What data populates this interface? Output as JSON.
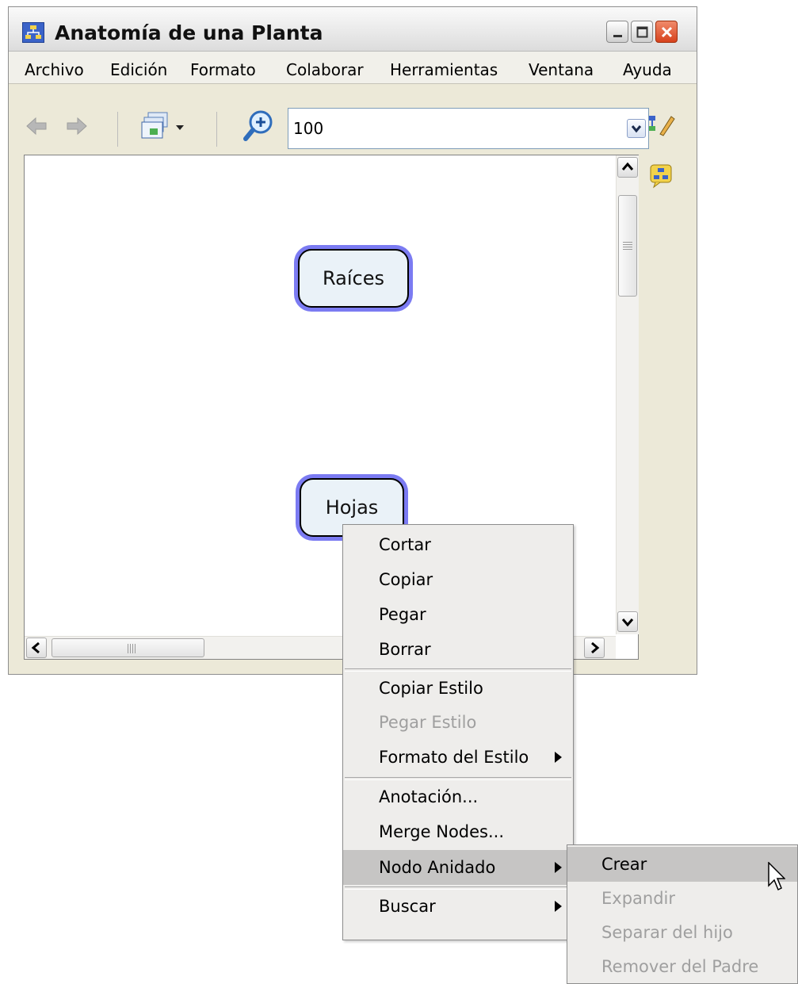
{
  "window": {
    "title": "Anatomía de una Planta",
    "controls": [
      "minimize",
      "maximize",
      "close"
    ]
  },
  "menubar": {
    "items": [
      "Archivo",
      "Edición",
      "Formato",
      "Colaborar",
      "Herramientas",
      "Ventana",
      "Ayuda"
    ]
  },
  "toolbar": {
    "icons": [
      "back-arrow-icon",
      "forward-arrow-icon",
      "view-selector-icon",
      "zoom-in-icon",
      "edit-style-icon"
    ],
    "zoom_value": "100"
  },
  "canvas": {
    "concepts": [
      "Raíces",
      "Hojas"
    ],
    "concept_fill": "#eaf2f8",
    "concept_halo": "#7b7bf2"
  },
  "context_menu": {
    "items": [
      {
        "label": "Cortar",
        "enabled": true
      },
      {
        "label": "Copiar",
        "enabled": true
      },
      {
        "label": "Pegar",
        "enabled": true
      },
      {
        "label": "Borrar",
        "enabled": true
      },
      {
        "label": "Copiar Estilo",
        "enabled": true
      },
      {
        "label": "Pegar Estilo",
        "enabled": false
      },
      {
        "label": "Formato del Estilo",
        "enabled": true,
        "submenu": true
      },
      {
        "label": "Anotación...",
        "enabled": true
      },
      {
        "label": "Merge Nodes...",
        "enabled": true
      },
      {
        "label": "Nodo Anidado",
        "enabled": true,
        "submenu": true,
        "highlighted": true
      },
      {
        "label": "Buscar",
        "enabled": true,
        "submenu": true
      }
    ]
  },
  "submenu": {
    "items": [
      {
        "label": "Crear",
        "enabled": true,
        "highlighted": true
      },
      {
        "label": "Expandir",
        "enabled": false
      },
      {
        "label": "Separar del hijo",
        "enabled": false
      },
      {
        "label": "Remover del Padre",
        "enabled": false
      }
    ]
  }
}
